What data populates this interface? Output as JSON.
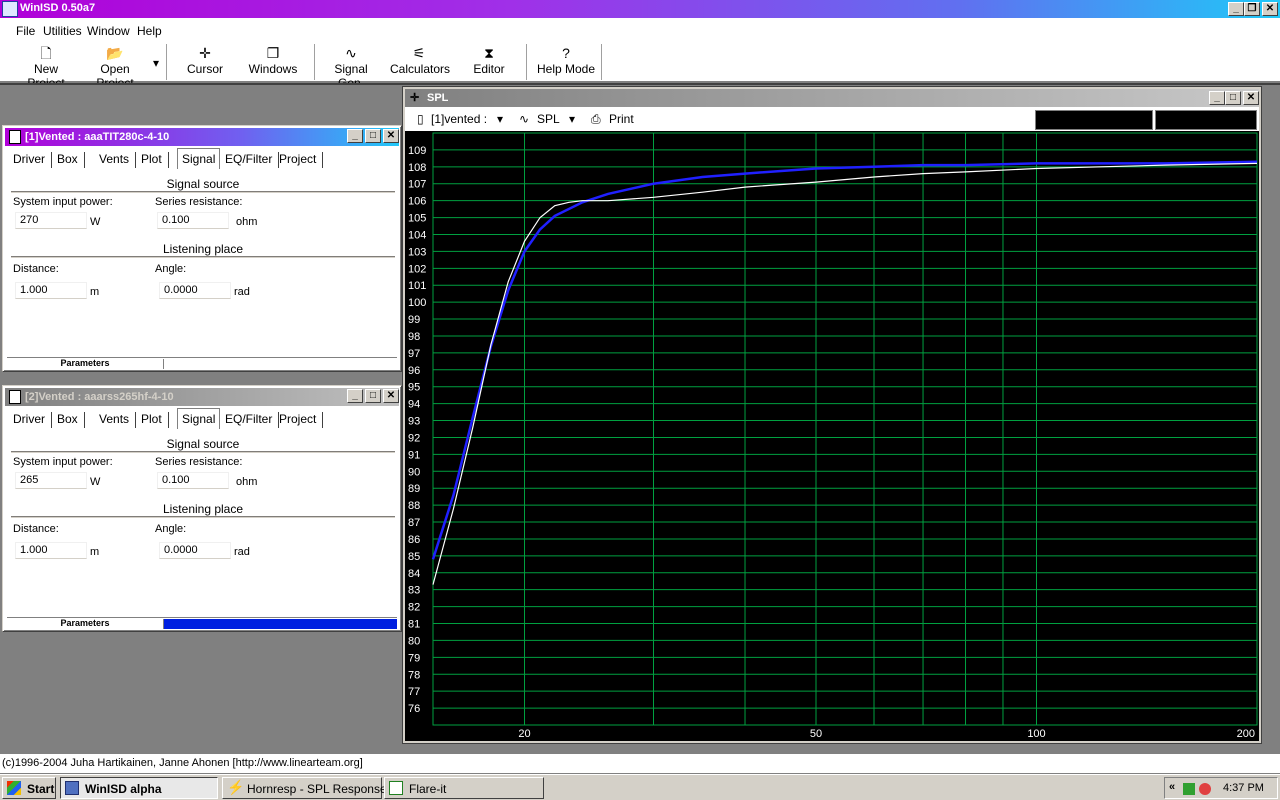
{
  "app": {
    "title": "WinISD 0.50a7",
    "caption_buttons": [
      "_",
      "❐",
      "✕"
    ]
  },
  "menu": [
    "File",
    "Utilities",
    "Window",
    "Help"
  ],
  "toolbar": {
    "buttons": [
      {
        "label": "New Project",
        "icon": "🗋"
      },
      {
        "label": "Open Project",
        "icon": "📂"
      },
      {
        "label": "Cursor",
        "icon": "✛"
      },
      {
        "label": "Windows",
        "icon": "❐"
      },
      {
        "label": "Signal Gen.",
        "icon": "∿"
      },
      {
        "label": "Calculators",
        "icon": "⚟"
      },
      {
        "label": "Editor",
        "icon": "⧗"
      },
      {
        "label": "Help Mode",
        "icon": "?"
      }
    ],
    "dropdown_arrow": "▾"
  },
  "project1": {
    "title": "[1]Vented : aaaTIT280c-4-10",
    "tabs": [
      "Driver",
      "Box",
      "Vents",
      "Plot",
      "Signal",
      "EQ/Filter",
      "Project"
    ],
    "selected_tab": "Signal",
    "signal_source_header": "Signal source",
    "input_power_label": "System input power:",
    "input_power_value": "270",
    "input_power_unit": "W",
    "series_resistance_label": "Series resistance:",
    "series_resistance_value": "0.100",
    "series_resistance_unit": "ohm",
    "listening_place_header": "Listening place",
    "distance_label": "Distance:",
    "distance_value": "1.000",
    "distance_unit": "m",
    "angle_label": "Angle:",
    "angle_value": "0.0000",
    "angle_unit": "rad",
    "params_label": "Parameters",
    "params_bar_color": "#ffffff"
  },
  "project2": {
    "title": "[2]Vented : aaarss265hf-4-10",
    "tabs": [
      "Driver",
      "Box",
      "Vents",
      "Plot",
      "Signal",
      "EQ/Filter",
      "Project"
    ],
    "selected_tab": "Signal",
    "signal_source_header": "Signal source",
    "input_power_label": "System input power:",
    "input_power_value": "265",
    "input_power_unit": "W",
    "series_resistance_label": "Series resistance:",
    "series_resistance_value": "0.100",
    "series_resistance_unit": "ohm",
    "listening_place_header": "Listening place",
    "distance_label": "Distance:",
    "distance_value": "1.000",
    "distance_unit": "m",
    "angle_label": "Angle:",
    "angle_value": "0.0000",
    "angle_unit": "rad",
    "params_label": "Parameters",
    "params_bar_color": "#0020e0"
  },
  "spl_window": {
    "title": "SPL",
    "project_select": "[1]vented :",
    "graph_select": "SPL",
    "print_label": "Print",
    "caption_buttons": [
      "_",
      "□",
      "✕"
    ]
  },
  "chart_data": {
    "type": "line",
    "xscale": "log",
    "xlim": [
      15,
      200
    ],
    "ylim": [
      75,
      110
    ],
    "x_ticks": [
      20,
      50,
      100,
      200
    ],
    "y_ticks": [
      76,
      77,
      78,
      79,
      80,
      81,
      82,
      83,
      84,
      85,
      86,
      87,
      88,
      89,
      90,
      91,
      92,
      93,
      94,
      95,
      96,
      97,
      98,
      99,
      100,
      101,
      102,
      103,
      104,
      105,
      106,
      107,
      108,
      109
    ],
    "grid": true,
    "background": "#000000",
    "grid_color": "#00a040",
    "series": [
      {
        "color": "#2020ff",
        "x": [
          15,
          16,
          17,
          18,
          19,
          20,
          21,
          22,
          24,
          26,
          30,
          35,
          40,
          50,
          60,
          70,
          80,
          100,
          150,
          200
        ],
        "y": [
          84.8,
          88.6,
          93.2,
          97.4,
          100.7,
          103.0,
          104.3,
          105.1,
          105.9,
          106.4,
          107.0,
          107.4,
          107.6,
          107.9,
          108.0,
          108.1,
          108.1,
          108.2,
          108.2,
          108.3
        ]
      },
      {
        "color": "#ffffff",
        "x": [
          15,
          16,
          17,
          18,
          19,
          20,
          21,
          22,
          23,
          24,
          26,
          30,
          35,
          40,
          50,
          60,
          70,
          80,
          100,
          150,
          200
        ],
        "y": [
          83.3,
          87.8,
          92.6,
          97.5,
          101.2,
          103.6,
          105.0,
          105.7,
          105.9,
          106.0,
          106.0,
          106.2,
          106.5,
          106.8,
          107.1,
          107.4,
          107.6,
          107.7,
          107.9,
          108.1,
          108.2
        ]
      }
    ]
  },
  "status": {
    "text": "(c)1996-2004 Juha Hartikainen, Janne Ahonen [http://www.linearteam.org]"
  },
  "taskbar": {
    "start_label": "Start",
    "tasks": [
      "WinISD alpha",
      "Hornresp - SPL Response",
      "Flare-it"
    ],
    "clock": "4:37 PM",
    "tray_arrow": "«"
  }
}
